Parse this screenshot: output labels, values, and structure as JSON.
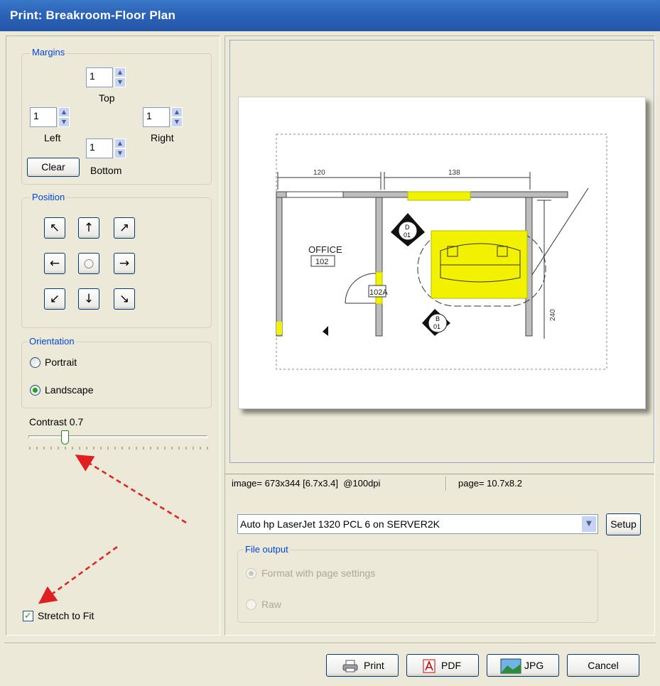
{
  "window": {
    "title": "Print: Breakroom-Floor Plan"
  },
  "margins": {
    "group_label": "Margins",
    "top_value": "1",
    "top_label": "Top",
    "left_value": "1",
    "left_label": "Left",
    "right_value": "1",
    "right_label": "Right",
    "bottom_value": "1",
    "bottom_label": "Bottom",
    "clear_label": "Clear"
  },
  "position": {
    "group_label": "Position"
  },
  "orientation": {
    "group_label": "Orientation",
    "portrait_label": "Portrait",
    "landscape_label": "Landscape",
    "selected": "Landscape"
  },
  "contrast": {
    "label": "Contrast 0.7",
    "value": 0.7
  },
  "stretch": {
    "label": "Stretch to Fit",
    "checked": true
  },
  "preview": {
    "office_label": "OFFICE",
    "room_number": "102",
    "door_label": "102A",
    "dim_top_left": "120",
    "dim_top_right": "138",
    "dim_side": "240",
    "marker_d": "D",
    "marker_d_sub": "01",
    "marker_b": "B",
    "marker_b_sub": "01"
  },
  "status": {
    "image_info": "image= 673x344 [6.7x3.4]  @100dpi",
    "page_info": "page= 10.7x8.2"
  },
  "printer": {
    "selected": "Auto hp LaserJet 1320 PCL 6 on SERVER2K",
    "setup_label": "Setup"
  },
  "file_output": {
    "group_label": "File output",
    "format_label": "Format with page settings",
    "raw_label": "Raw"
  },
  "buttons": {
    "print": "Print",
    "pdf": "PDF",
    "jpg": "JPG",
    "cancel": "Cancel"
  },
  "colors": {
    "title_bar": "#2B63B8",
    "highlight": "#F2F200",
    "annotation_arrow": "#E02020"
  }
}
